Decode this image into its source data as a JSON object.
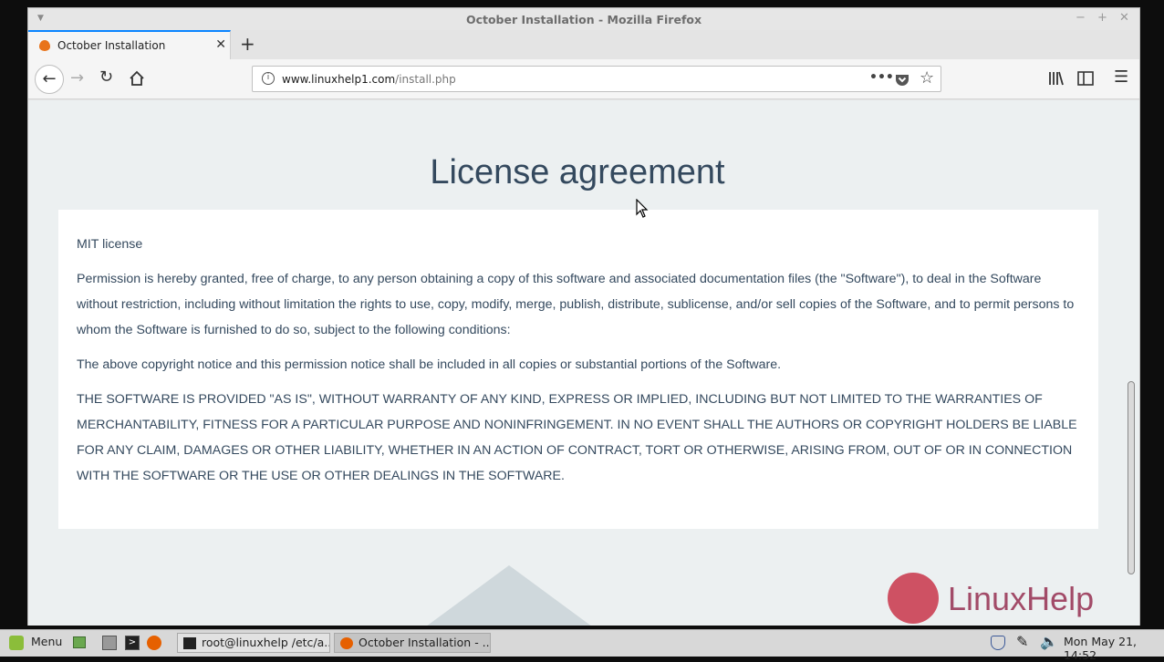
{
  "window": {
    "title": "October Installation - Mozilla Firefox"
  },
  "tabs": [
    {
      "label": "October Installation"
    }
  ],
  "toolbar": {
    "url_host": "www.linuxhelp1.com",
    "url_path": "/install.php"
  },
  "page": {
    "heading": "License agreement",
    "license": {
      "name": "MIT license",
      "p1": "Permission is hereby granted, free of charge, to any person obtaining a copy of this software and associated documentation files (the \"Software\"), to deal in the Software without restriction, including without limitation the rights to use, copy, modify, merge, publish, distribute, sublicense, and/or sell copies of the Software, and to permit persons to whom the Software is furnished to do so, subject to the following conditions:",
      "p2": "The above copyright notice and this permission notice shall be included in all copies or substantial portions of the Software.",
      "p3": "THE SOFTWARE IS PROVIDED \"AS IS\", WITHOUT WARRANTY OF ANY KIND, EXPRESS OR IMPLIED, INCLUDING BUT NOT LIMITED TO THE WARRANTIES OF MERCHANTABILITY, FITNESS FOR A PARTICULAR PURPOSE AND NONINFRINGEMENT. IN NO EVENT SHALL THE AUTHORS OR COPYRIGHT HOLDERS BE LIABLE FOR ANY CLAIM, DAMAGES OR OTHER LIABILITY, WHETHER IN AN ACTION OF CONTRACT, TORT OR OTHERWISE, ARISING FROM, OUT OF OR IN CONNECTION WITH THE SOFTWARE OR THE USE OR OTHER DEALINGS IN THE SOFTWARE."
    },
    "watermark": "LinuxHelp"
  },
  "taskbar": {
    "menu_label": "Menu",
    "windows": [
      {
        "label": "root@linuxhelp /etc/a..."
      },
      {
        "label": "October Installation - ..."
      }
    ],
    "clock": "Mon May 21, 14:52"
  },
  "colors": {
    "accent": "#0a84ff",
    "heading": "#34495e",
    "page_bg": "#ecf0f1"
  }
}
